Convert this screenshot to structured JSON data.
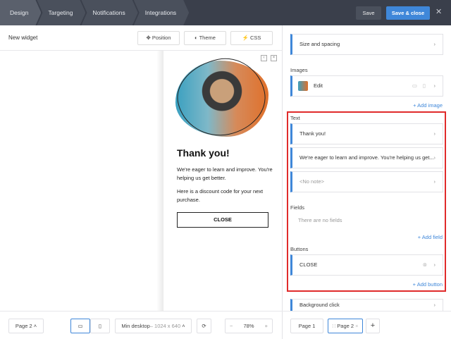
{
  "header": {
    "tabs": [
      "Design",
      "Targeting",
      "Notifications",
      "Integrations"
    ],
    "save": "Save",
    "save_close": "Save & close"
  },
  "toolbar": {
    "title": "New widget",
    "position": "Position",
    "theme": "Theme",
    "css": "CSS"
  },
  "preview": {
    "heading": "Thank you!",
    "body1": "We're eager to learn and improve. You're helping us get better.",
    "body2": "Here is a discount code for your next purchase.",
    "button": "CLOSE"
  },
  "panel": {
    "size_spacing": "Size and spacing",
    "images_label": "Images",
    "image_edit": "Edit",
    "add_image": "+ Add image",
    "text_label": "Text",
    "texts": [
      "Thank you!",
      "We're eager to learn and improve. You're helping us get...",
      "<No note>"
    ],
    "fields_label": "Fields",
    "no_fields": "There are no fields",
    "add_field": "+ Add field",
    "buttons_label": "Buttons",
    "button_item": "CLOSE",
    "add_button": "+ Add button",
    "background_click": "Background click"
  },
  "bottom": {
    "page_select": "Page 2",
    "device": "Min desktop",
    "resolution": "– 1024 x 640",
    "zoom": "78%",
    "pages": [
      "Page 1",
      "Page 2"
    ]
  },
  "colors": {
    "accent": "#3f87d9",
    "topbar": "#3a3f4b",
    "highlight": "#e02b2b"
  }
}
